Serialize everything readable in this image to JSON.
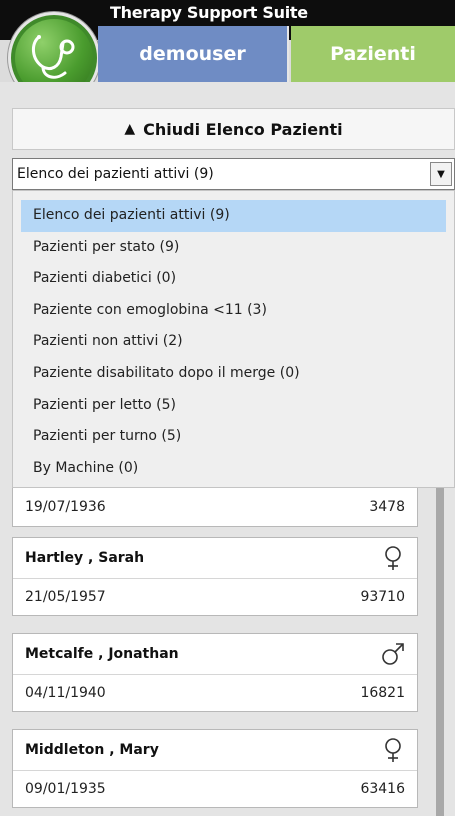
{
  "app": {
    "title": "Therapy Support Suite"
  },
  "tabs": {
    "user": "demouser",
    "patients": "Pazienti"
  },
  "close_button": {
    "label": "Chiudi Elenco Pazienti"
  },
  "select": {
    "value": "Elenco dei pazienti attivi (9)"
  },
  "dropdown": {
    "items": [
      "Elenco dei pazienti attivi (9)",
      "Pazienti per stato (9)",
      "Pazienti diabetici (0)",
      "Paziente con emoglobina <11 (3)",
      "Pazienti non attivi (2)",
      "Paziente disabilitato dopo il merge (0)",
      "Pazienti per letto (5)",
      "Pazienti per turno (5)",
      "By Machine (0)"
    ]
  },
  "patients": [
    {
      "name": "",
      "birth": "19/07/1936",
      "id": "3478",
      "gender": ""
    },
    {
      "name": "Hartley , Sarah",
      "birth": "21/05/1957",
      "id": "93710",
      "gender": "female"
    },
    {
      "name": "Metcalfe , Jonathan",
      "birth": "04/11/1940",
      "id": "16821",
      "gender": "male"
    },
    {
      "name": "Middleton , Mary",
      "birth": "09/01/1935",
      "id": "63416",
      "gender": "female"
    }
  ],
  "colors": {
    "user_tab": "#6f8cc4",
    "patients_tab": "#9fcb6a",
    "logo": "#4a9c2e",
    "selected_item": "#b5d7f6"
  }
}
